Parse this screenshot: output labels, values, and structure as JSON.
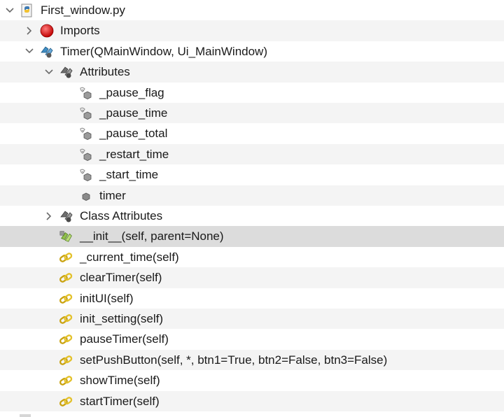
{
  "tree": {
    "items": [
      {
        "label": "First_window.py",
        "expander": "expanded",
        "icon": "python-file-icon",
        "depth": 0
      },
      {
        "label": "Imports",
        "expander": "collapsed",
        "icon": "imports-icon",
        "depth": 1
      },
      {
        "label": "Timer(QMainWindow, Ui_MainWindow)",
        "expander": "expanded",
        "icon": "class-icon",
        "depth": 1
      },
      {
        "label": "Attributes",
        "expander": "expanded",
        "icon": "attributes-icon",
        "depth": 2
      },
      {
        "label": "_pause_flag",
        "expander": "none",
        "icon": "private-attribute-icon",
        "depth": 3
      },
      {
        "label": "_pause_time",
        "expander": "none",
        "icon": "private-attribute-icon",
        "depth": 3
      },
      {
        "label": "_pause_total",
        "expander": "none",
        "icon": "private-attribute-icon",
        "depth": 3
      },
      {
        "label": "_restart_time",
        "expander": "none",
        "icon": "private-attribute-icon",
        "depth": 3
      },
      {
        "label": "_start_time",
        "expander": "none",
        "icon": "private-attribute-icon",
        "depth": 3
      },
      {
        "label": "timer",
        "expander": "none",
        "icon": "attribute-icon",
        "depth": 3
      },
      {
        "label": "Class Attributes",
        "expander": "collapsed",
        "icon": "attributes-icon",
        "depth": 2
      },
      {
        "label": "__init__(self, parent=None)",
        "expander": "none",
        "icon": "constructor-icon",
        "depth": 2,
        "selected": true
      },
      {
        "label": "_current_time(self)",
        "expander": "none",
        "icon": "method-icon",
        "depth": 2
      },
      {
        "label": "clearTimer(self)",
        "expander": "none",
        "icon": "method-icon",
        "depth": 2
      },
      {
        "label": "initUI(self)",
        "expander": "none",
        "icon": "method-icon",
        "depth": 2
      },
      {
        "label": "init_setting(self)",
        "expander": "none",
        "icon": "method-icon",
        "depth": 2
      },
      {
        "label": "pauseTimer(self)",
        "expander": "none",
        "icon": "method-icon",
        "depth": 2
      },
      {
        "label": "setPushButton(self, *, btn1=True, btn2=False, btn3=False)",
        "expander": "none",
        "icon": "method-icon",
        "depth": 2
      },
      {
        "label": "showTime(self)",
        "expander": "none",
        "icon": "method-icon",
        "depth": 2
      },
      {
        "label": "startTimer(self)",
        "expander": "none",
        "icon": "method-icon",
        "depth": 2
      }
    ]
  },
  "colors": {
    "row_alt": "#f4f4f4",
    "row_selected": "#dcdcdc",
    "method_gold": "#e3c12b",
    "constructor_green": "#8fc04a",
    "class_blue": "#3f8dc4",
    "imports_red": "#d81e1e",
    "attribute_gray": "#9a9a9a",
    "arrow_gray": "#6b6b6b"
  }
}
